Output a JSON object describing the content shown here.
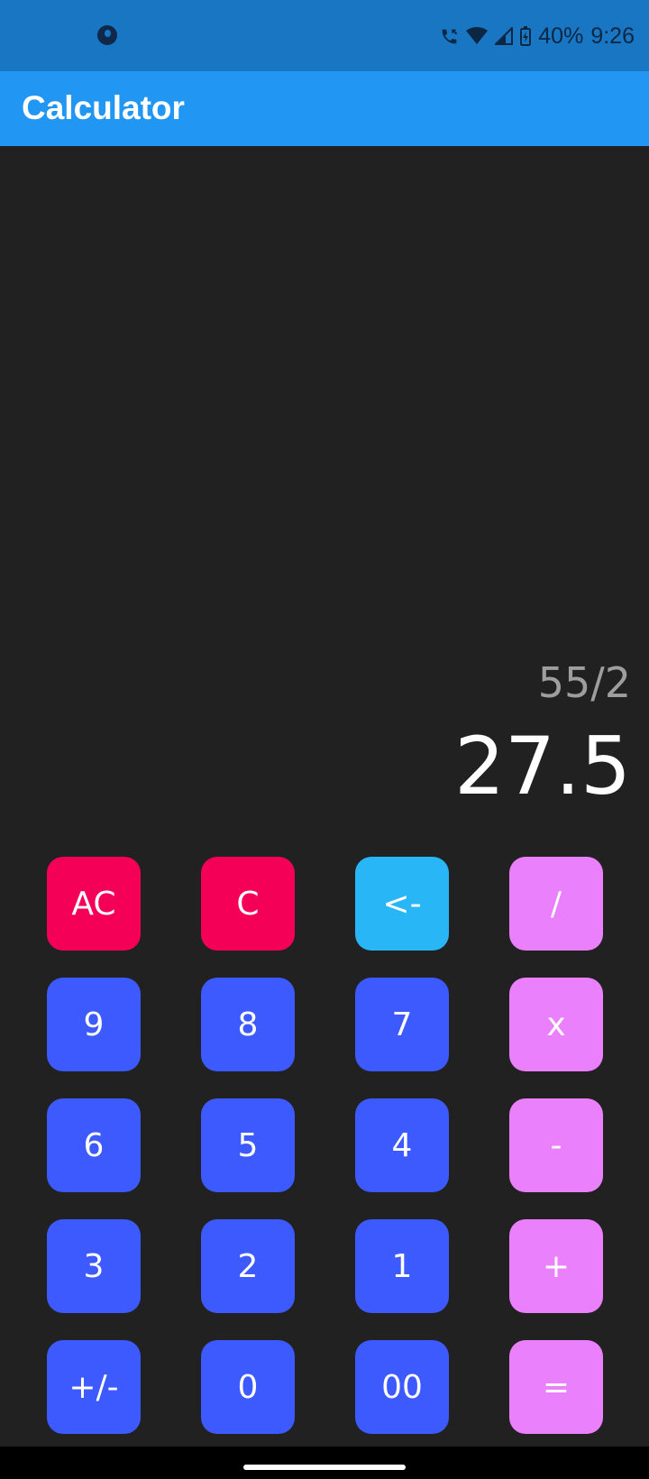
{
  "status_bar": {
    "battery": "40%",
    "time": "9:26",
    "icons": [
      "app-notification-icon",
      "wifi-call-icon",
      "wifi-icon",
      "signal-icon",
      "battery-charging-icon"
    ]
  },
  "app_bar": {
    "title": "Calculator",
    "color": "#2196f3"
  },
  "display": {
    "expression": "55/2",
    "result": "27.5"
  },
  "keypad": {
    "rows": [
      [
        "AC",
        "C",
        "<-",
        "/"
      ],
      [
        "9",
        "8",
        "7",
        "x"
      ],
      [
        "6",
        "5",
        "4",
        "-"
      ],
      [
        "3",
        "2",
        "1",
        "+"
      ],
      [
        "+/-",
        "0",
        "00",
        "="
      ]
    ]
  },
  "colors": {
    "background": "#212121",
    "status_bar": "#1976c2",
    "number_key": "#3d5afe",
    "clear_key": "#f50057",
    "backspace_key": "#29b6f6",
    "operator_key": "#ea80fc",
    "expression_text": "#9e9e9e"
  }
}
